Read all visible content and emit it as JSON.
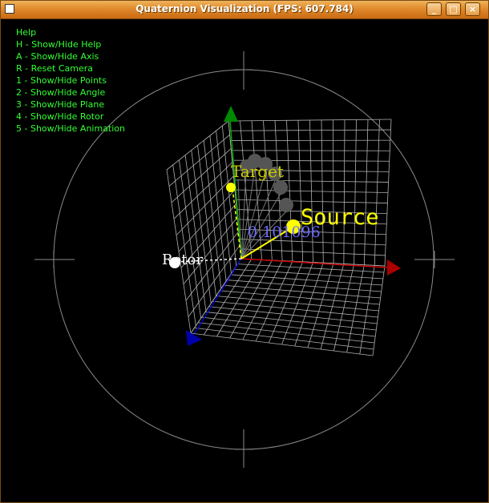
{
  "window": {
    "title": "Quaternion Visualization  (FPS: 607.784)",
    "buttons": {
      "minimize": "_",
      "maximize": "□",
      "close": "×"
    }
  },
  "help": {
    "heading": "Help",
    "items": [
      "H - Show/Hide Help",
      "A - Show/Hide Axis",
      "R - Reset Camera",
      "1 - Show/Hide Points",
      "2 - Show/Hide Angle",
      "3 - Show/Hide Plane",
      "4 - Show/Hide Rotor",
      "5 - Show/Hide Animation"
    ]
  },
  "scene": {
    "labels": {
      "source": "Source",
      "target": "Target",
      "rotor": "Rotor",
      "angle": "0.101096"
    },
    "colors": {
      "help_text": "#33ff33",
      "x_axis": "#cc0000",
      "y_axis": "#00aa00",
      "z_axis": "#0000cc",
      "source": "#ffff00",
      "target": "#ffff00",
      "rotor": "#ffffff",
      "angle_label": "#6a6aff",
      "grid": "#b0b0b0",
      "trackball": "#8a8a8a"
    }
  }
}
